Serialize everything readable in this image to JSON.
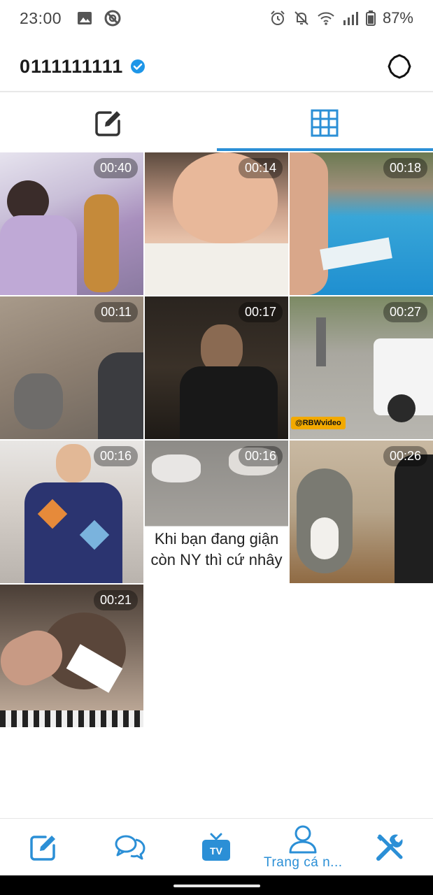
{
  "status_bar": {
    "time": "23:00",
    "battery": "87%",
    "icons": [
      "image-icon",
      "no-signal-icon",
      "alarm-icon",
      "mute-icon",
      "wifi-icon",
      "signal-icon",
      "battery-icon"
    ]
  },
  "header": {
    "profile_name": "0111111111",
    "verified_icon": "verified-check-icon",
    "settings_icon": "settings-gear-icon"
  },
  "tabs": [
    {
      "icon": "edit-icon",
      "active": false
    },
    {
      "icon": "grid-icon",
      "active": true
    }
  ],
  "videos": [
    {
      "duration": "00:40"
    },
    {
      "duration": "00:14"
    },
    {
      "duration": "00:18"
    },
    {
      "duration": "00:11"
    },
    {
      "duration": "00:17"
    },
    {
      "duration": "00:27",
      "watermark": "@RBWvideo"
    },
    {
      "duration": "00:16"
    },
    {
      "duration": "00:16",
      "caption": "Khi bạn đang giận còn NY thì cứ nhây"
    },
    {
      "duration": "00:26"
    },
    {
      "duration": "00:21"
    }
  ],
  "bottom_nav": [
    {
      "icon": "compose-icon",
      "label": ""
    },
    {
      "icon": "chat-icon",
      "label": ""
    },
    {
      "icon": "tv-icon",
      "label": ""
    },
    {
      "icon": "profile-icon",
      "label": "Trang cá n..."
    },
    {
      "icon": "tools-icon",
      "label": ""
    }
  ],
  "colors": {
    "accent": "#2b8fd6",
    "verified": "#1e96e8"
  }
}
